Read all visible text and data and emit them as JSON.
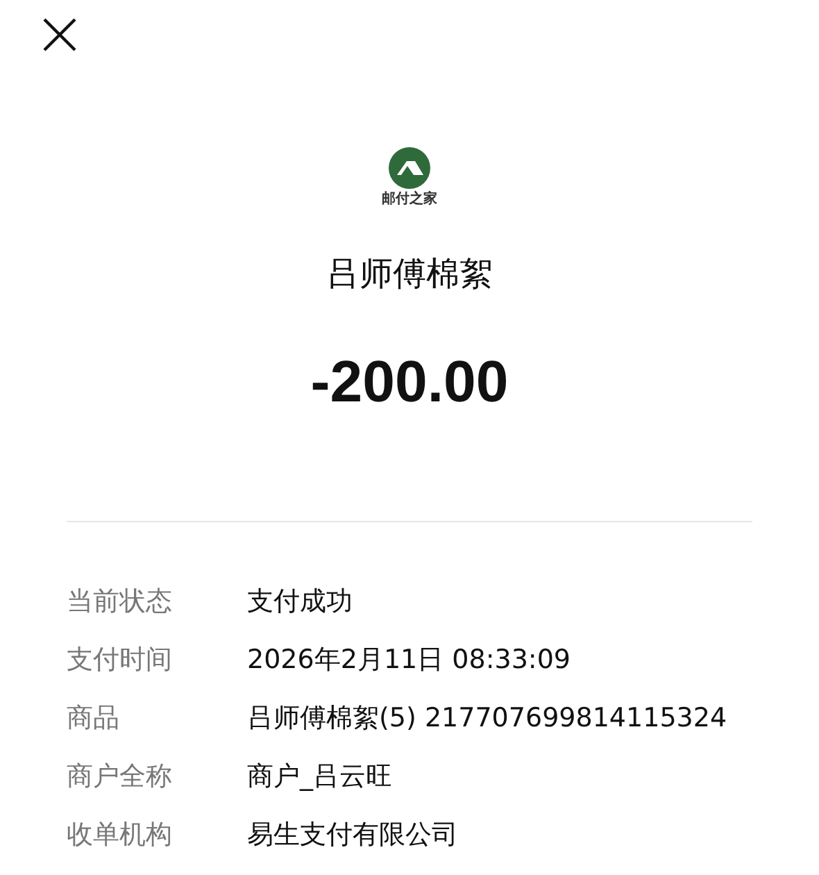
{
  "logo": {
    "text": "邮付之家"
  },
  "merchant": "吕师傅棉絮",
  "amount": "-200.00",
  "details": [
    {
      "label": "当前状态",
      "value": "支付成功"
    },
    {
      "label": "支付时间",
      "value": "2026年2月11日 08:33:09"
    },
    {
      "label": "商品",
      "value": "吕师傅棉絮(5) 217707699814115324"
    },
    {
      "label": "商户全称",
      "value": "商户_吕云旺"
    },
    {
      "label": "收单机构",
      "value": "易生支付有限公司"
    }
  ]
}
